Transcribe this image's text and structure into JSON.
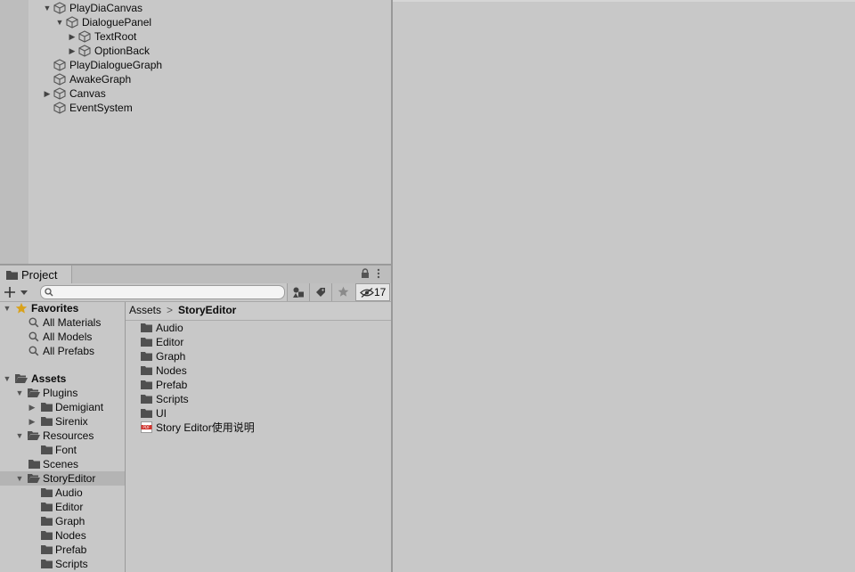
{
  "hierarchy": {
    "items": [
      {
        "label": "PlayDiaCanvas",
        "expanded": "open"
      },
      {
        "label": "DialoguePanel",
        "expanded": "open"
      },
      {
        "label": "TextRoot",
        "expanded": "closed"
      },
      {
        "label": "OptionBack",
        "expanded": "closed"
      },
      {
        "label": "PlayDialogueGraph",
        "expanded": "none"
      },
      {
        "label": "AwakeGraph",
        "expanded": "none"
      },
      {
        "label": "Canvas",
        "expanded": "closed"
      },
      {
        "label": "EventSystem",
        "expanded": "none"
      }
    ]
  },
  "project": {
    "tab_label": "Project",
    "visibility_count": "17",
    "search": {
      "value": "",
      "placeholder": ""
    },
    "breadcrumb": {
      "root": "Assets",
      "separator": ">",
      "current": "StoryEditor"
    },
    "tree": {
      "favorites": {
        "label": "Favorites",
        "items": [
          "All Materials",
          "All Models",
          "All Prefabs"
        ]
      },
      "assets": {
        "label": "Assets",
        "plugins": {
          "label": "Plugins",
          "children": [
            "Demigiant",
            "Sirenix"
          ]
        },
        "resources": {
          "label": "Resources",
          "children": [
            "Font"
          ]
        },
        "scenes": "Scenes",
        "story_editor": {
          "label": "StoryEditor",
          "children": [
            "Audio",
            "Editor",
            "Graph",
            "Nodes",
            "Prefab",
            "Scripts"
          ]
        }
      }
    },
    "contents": {
      "folders": [
        "Audio",
        "Editor",
        "Graph",
        "Nodes",
        "Prefab",
        "Scripts",
        "UI"
      ],
      "file": "Story Editor使用说明",
      "file_badge": "PDF"
    }
  },
  "colors": {
    "panel": "#c8c8c8",
    "selected_row": "#b4b4b4",
    "favorite_star": "#d9a21b",
    "pdf_red": "#d0302a",
    "folder": "#505050"
  }
}
